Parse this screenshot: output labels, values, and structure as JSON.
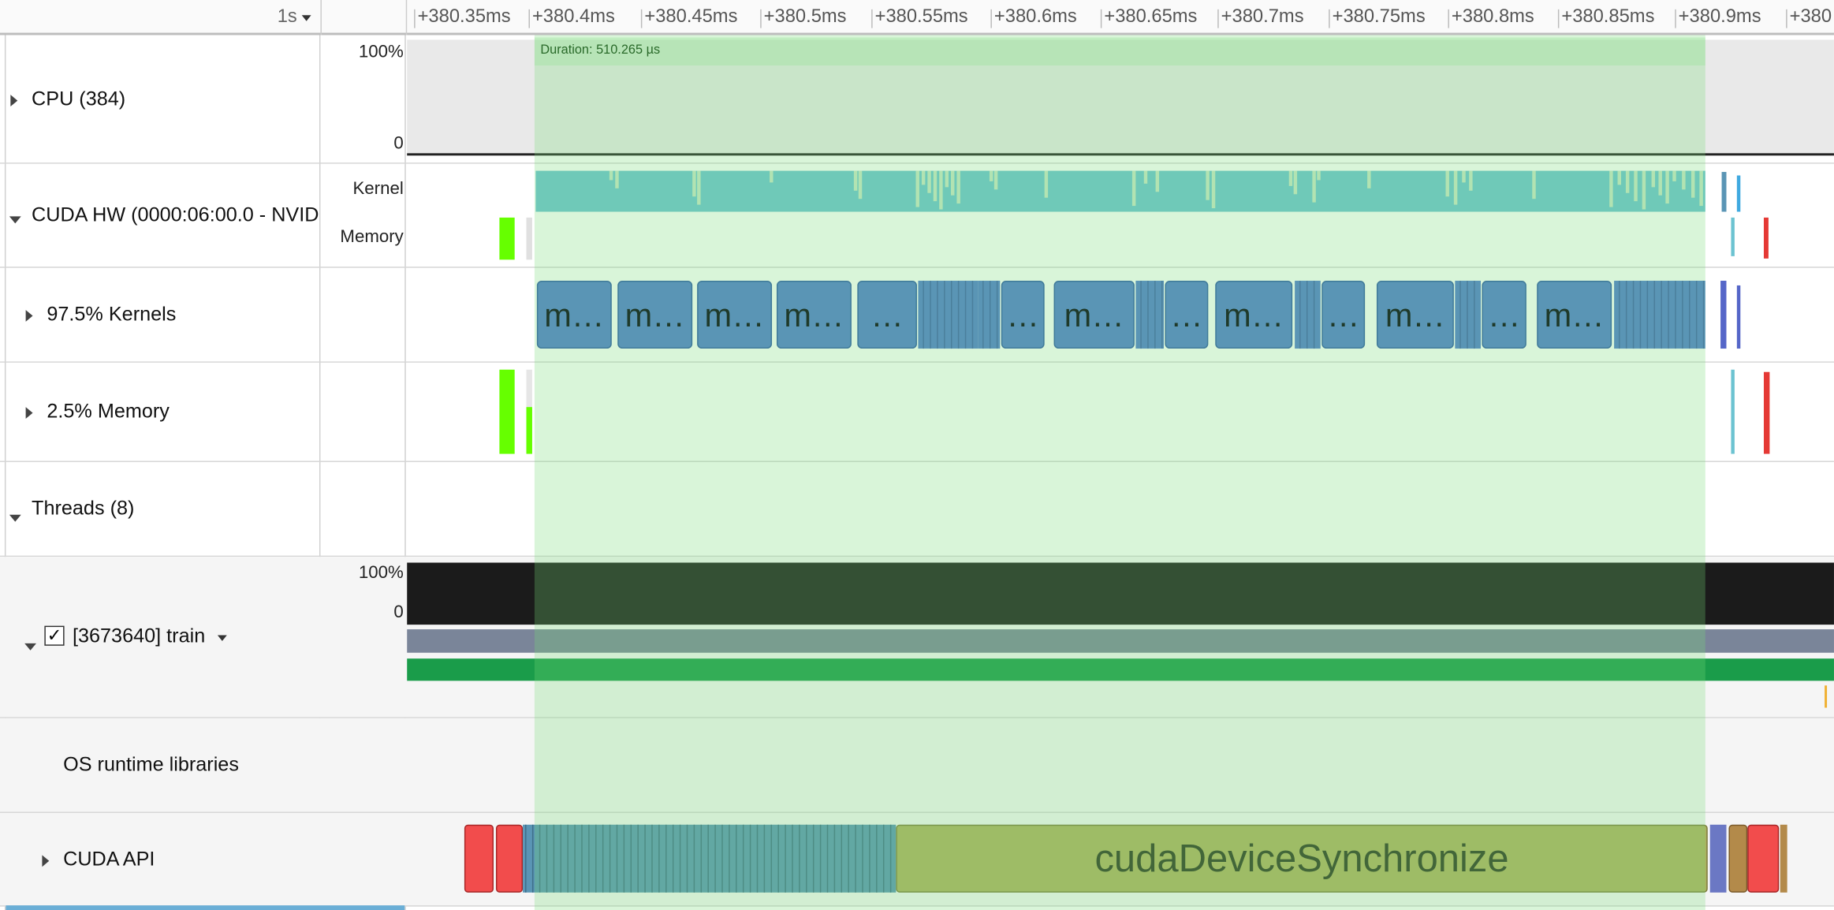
{
  "header": {
    "zoom_label": "1s",
    "ticks": [
      "+380.35ms",
      "+380.4ms",
      "+380.45ms",
      "+380.5ms",
      "+380.55ms",
      "+380.6ms",
      "+380.65ms",
      "+380.7ms",
      "+380.75ms",
      "+380.8ms",
      "+380.85ms",
      "+380.9ms",
      "+380"
    ]
  },
  "selection": {
    "duration_label": "Duration: 510.265 µs",
    "color": "#b8ecb8"
  },
  "rows": {
    "cpu": {
      "label": "CPU (384)",
      "axis_top": "100%",
      "axis_bottom": "0"
    },
    "cuda_hw": {
      "label": "CUDA HW (0000:06:00.0 - NVIDI",
      "sub_kernel": "Kernel",
      "sub_memory": "Memory"
    },
    "kernels": {
      "label": "97.5% Kernels"
    },
    "memory": {
      "label": "2.5% Memory"
    },
    "threads": {
      "label": "Threads (8)"
    },
    "train": {
      "label": "[3673640] train",
      "axis_top": "100%",
      "axis_bottom": "0",
      "checked": true
    },
    "os_runtime": {
      "label": "OS runtime libraries"
    },
    "cuda_api": {
      "label": "CUDA API",
      "sync_label": "cudaDeviceSynchronize"
    }
  },
  "kernel_block_labels": [
    "m…",
    "m…",
    "m…",
    "m…",
    "…",
    "…",
    "m…",
    "…",
    "m…",
    "…",
    "m…",
    "…",
    "m…"
  ],
  "colors": {
    "kernel": "#5a95b5",
    "kernel_hw": "#6cc3d1",
    "memory_green": "#66ff00",
    "memory_red": "#e53935",
    "sync": "#aeb060",
    "api_red": "#f24c4c",
    "thread_green": "#1a9c4a"
  }
}
